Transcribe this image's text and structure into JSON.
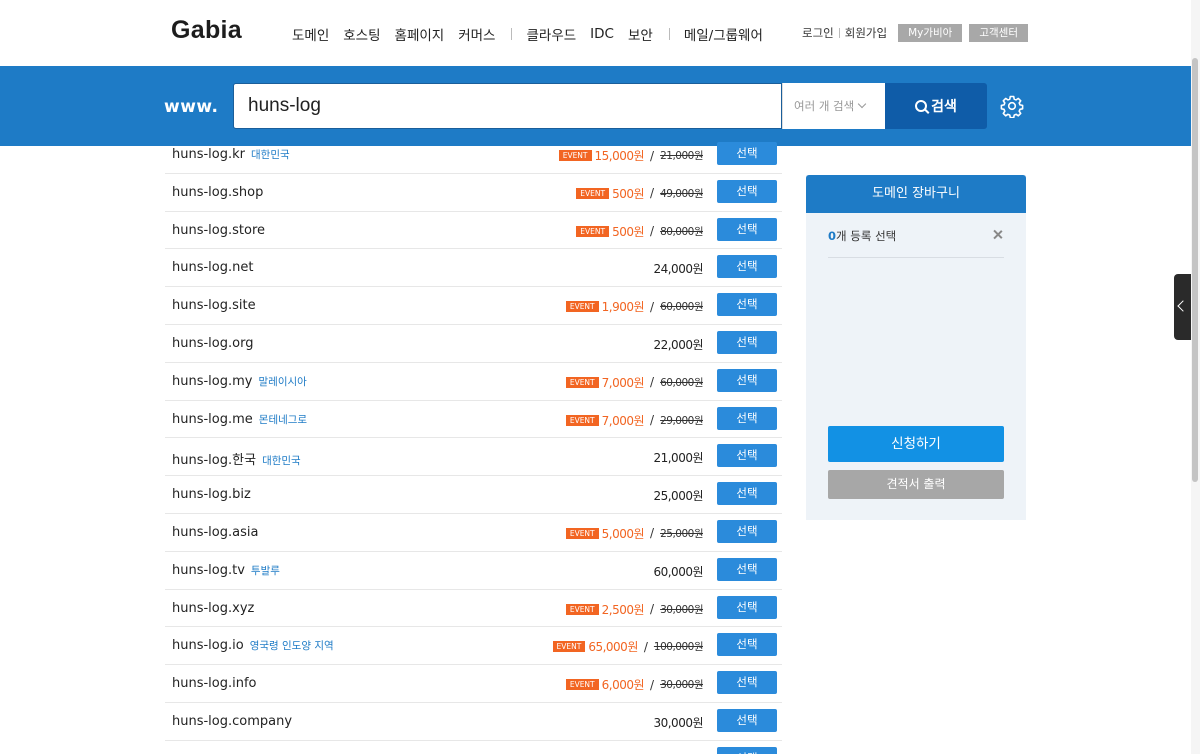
{
  "header": {
    "logo": "Gabia",
    "nav": [
      {
        "label": "도메인"
      },
      {
        "label": "호스팅"
      },
      {
        "label": "홈페이지"
      },
      {
        "label": "커머스"
      },
      {
        "label": "클라우드"
      },
      {
        "label": "IDC"
      },
      {
        "label": "보안"
      },
      {
        "label": "메일/그룹웨어"
      }
    ],
    "util": {
      "login": "로그인",
      "signup": "회원가입",
      "mygabia": "My가비아",
      "support": "고객센터"
    }
  },
  "search": {
    "prefix": "www.",
    "value": "huns-log",
    "multi_label": "여러 개 검색",
    "button_label": "검색"
  },
  "results": [
    {
      "domain": "huns-log.kr",
      "country": "대한민국",
      "event": true,
      "price": "15,000원",
      "original": "21,000원",
      "select": "선택"
    },
    {
      "domain": "huns-log.shop",
      "country": "",
      "event": true,
      "price": "500원",
      "original": "49,000원",
      "select": "선택"
    },
    {
      "domain": "huns-log.store",
      "country": "",
      "event": true,
      "price": "500원",
      "original": "80,000원",
      "select": "선택"
    },
    {
      "domain": "huns-log.net",
      "country": "",
      "event": false,
      "price": "24,000원",
      "original": "",
      "select": "선택"
    },
    {
      "domain": "huns-log.site",
      "country": "",
      "event": true,
      "price": "1,900원",
      "original": "60,000원",
      "select": "선택"
    },
    {
      "domain": "huns-log.org",
      "country": "",
      "event": false,
      "price": "22,000원",
      "original": "",
      "select": "선택"
    },
    {
      "domain": "huns-log.my",
      "country": "말레이시아",
      "event": true,
      "price": "7,000원",
      "original": "60,000원",
      "select": "선택"
    },
    {
      "domain": "huns-log.me",
      "country": "몬테네그로",
      "event": true,
      "price": "7,000원",
      "original": "29,000원",
      "select": "선택"
    },
    {
      "domain": "huns-log.한국",
      "country": "대한민국",
      "event": false,
      "price": "21,000원",
      "original": "",
      "select": "선택"
    },
    {
      "domain": "huns-log.biz",
      "country": "",
      "event": false,
      "price": "25,000원",
      "original": "",
      "select": "선택"
    },
    {
      "domain": "huns-log.asia",
      "country": "",
      "event": true,
      "price": "5,000원",
      "original": "25,000원",
      "select": "선택"
    },
    {
      "domain": "huns-log.tv",
      "country": "투발루",
      "event": false,
      "price": "60,000원",
      "original": "",
      "select": "선택"
    },
    {
      "domain": "huns-log.xyz",
      "country": "",
      "event": true,
      "price": "2,500원",
      "original": "30,000원",
      "select": "선택"
    },
    {
      "domain": "huns-log.io",
      "country": "영국령 인도양 지역",
      "event": true,
      "price": "65,000원",
      "original": "100,000원",
      "select": "선택"
    },
    {
      "domain": "huns-log.info",
      "country": "",
      "event": true,
      "price": "6,000원",
      "original": "30,000원",
      "select": "선택"
    },
    {
      "domain": "huns-log.company",
      "country": "",
      "event": false,
      "price": "30,000원",
      "original": "",
      "select": "선택"
    },
    {
      "domain": "",
      "country": "",
      "event": false,
      "price": "",
      "original": "",
      "select": "선택"
    }
  ],
  "event_label": "EVENT",
  "cart": {
    "title": "도메인 장바구니",
    "count": "0",
    "count_suffix": "개 등록 선택",
    "apply": "신청하기",
    "quote": "견적서 출력"
  },
  "colors": {
    "brand": "#1e7bc6",
    "event": "#f26522",
    "select_button": "#2b8bdb"
  }
}
